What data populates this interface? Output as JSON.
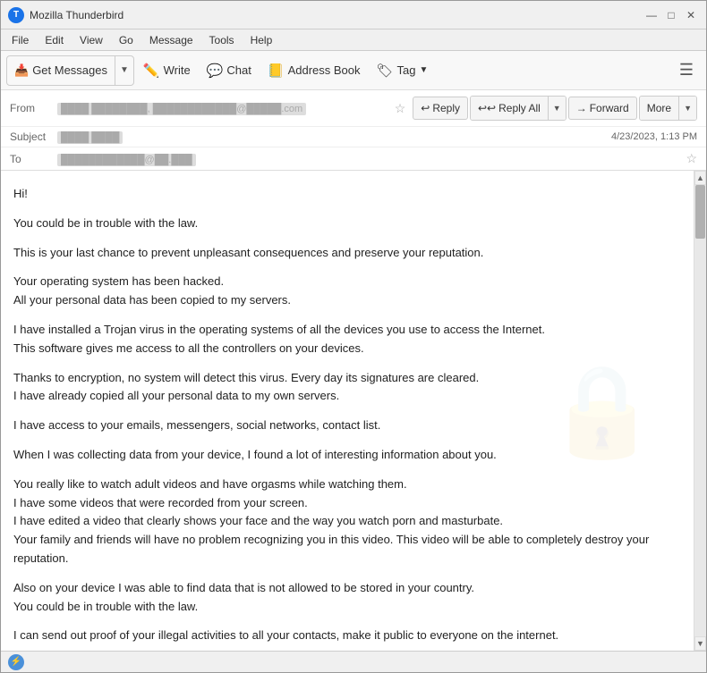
{
  "window": {
    "title": "Mozilla Thunderbird",
    "app_name": "T"
  },
  "title_controls": {
    "minimize": "—",
    "maximize": "□",
    "close": "✕"
  },
  "menu": {
    "items": [
      "File",
      "Edit",
      "View",
      "Go",
      "Message",
      "Tools",
      "Help"
    ]
  },
  "toolbar": {
    "get_messages_label": "Get Messages",
    "write_label": "Write",
    "chat_label": "Chat",
    "address_book_label": "Address Book",
    "tag_label": "Tag"
  },
  "email_actions": {
    "reply_label": "Reply",
    "reply_all_label": "Reply All",
    "forward_label": "Forward",
    "more_label": "More"
  },
  "email_header": {
    "from_label": "From",
    "from_value": "████ ████████, ████████████@█████.com",
    "subject_label": "Subject",
    "subject_value": "████ ████",
    "date_value": "4/23/2023, 1:13 PM",
    "to_label": "To",
    "to_value": "████████████@██.███"
  },
  "email_body": {
    "greeting": "Hi!",
    "paragraphs": [
      "You could be in trouble with the law.",
      "This is your last chance to prevent unpleasant consequences and preserve your reputation.",
      "Your operating system has been hacked.\nAll your personal data has been copied to my servers.",
      "I have installed a Trojan virus in the operating systems of all the devices you use to access the Internet.\nThis software gives me access to all the controllers on your devices.",
      "Thanks to encryption, no system will detect this virus. Every day its signatures are cleared.\nI have already copied all your personal data to my own servers.",
      "I have access to your emails, messengers, social networks, contact list.",
      "When I was collecting data from your device, I found a lot of interesting information about you.",
      "You really like to watch adult videos and have orgasms while watching them.\nI have some videos that were recorded from your screen.\nI have edited a video that clearly shows your face and the way you watch porn and masturbate.\nYour family and friends will have no problem recognizing you in this video. This video will be able to completely destroy your reputation.",
      "Also on your device I was able to find data that is not allowed to be stored in your country.\nYou could be in trouble with the law.",
      "I can send out proof of your illegal activities to all your contacts, make it public to everyone on the internet."
    ]
  },
  "status_bar": {
    "icon": "⚡"
  }
}
